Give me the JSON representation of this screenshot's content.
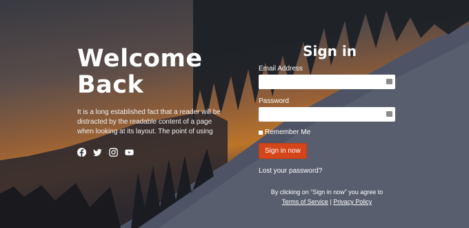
{
  "hero": {
    "title": "Welcome Back",
    "text": "It is a long established fact that a reader will be distracted by the readable content of a page when looking at its layout. The point of using",
    "social": [
      "facebook-icon",
      "twitter-icon",
      "instagram-icon",
      "youtube-icon"
    ]
  },
  "form": {
    "title": "Sign in",
    "email_label": "Email Address",
    "email_value": "",
    "password_label": "Password",
    "password_value": "",
    "remember_label": "Remember Me",
    "submit_label": "Sign in now",
    "lost_password": "Lost your password?",
    "agree_text": "By clicking on “Sign in now” you agree to",
    "terms_link": "Terms of Service",
    "separator": "|",
    "privacy_link": "Privacy Policy"
  },
  "colors": {
    "button": "#d4461a",
    "text": "#ffffff"
  }
}
